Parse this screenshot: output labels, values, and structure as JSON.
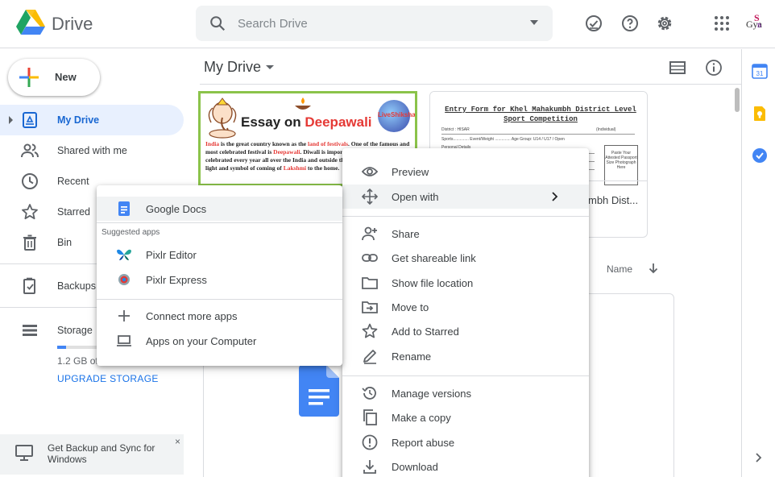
{
  "header": {
    "app_name": "Drive",
    "search_placeholder": "Search Drive",
    "icons": [
      "drive-logo",
      "search-icon",
      "dropdown-icon",
      "offline-check-icon",
      "help-icon",
      "settings-icon",
      "apps-grid-icon",
      "avatar"
    ],
    "avatar": {
      "line1": "S",
      "line2": "Gya",
      "line3": "n"
    }
  },
  "sidebar": {
    "new_label": "New",
    "items": [
      {
        "label": "My Drive",
        "icon": "my-drive-icon",
        "active": true
      },
      {
        "label": "Shared with me",
        "icon": "people-icon"
      },
      {
        "label": "Recent",
        "icon": "clock-icon"
      },
      {
        "label": "Starred",
        "icon": "star-icon"
      },
      {
        "label": "Bin",
        "icon": "trash-icon"
      },
      {
        "label": "Backups",
        "icon": "backup-icon"
      },
      {
        "label": "Storage",
        "icon": "storage-icon"
      }
    ],
    "storage_text": "1.2 GB of",
    "storage_fraction": 0.07,
    "upgrade_label": "UPGRADE STORAGE",
    "backup_banner": {
      "text": "Get Backup and Sync for Windows",
      "close": "×"
    }
  },
  "main": {
    "title": "My Drive",
    "sort_label": "Name",
    "file1": {
      "title_prefix": "Essay on ",
      "title_highlight": "Deepawali",
      "brand": "LiveShiksha",
      "body": [
        {
          "t": "India",
          "r": true
        },
        {
          "t": " is the great country known as the ",
          "r": false
        },
        {
          "t": "land of festivals",
          "r": true
        },
        {
          "t": ". One of the famous and most celebrated festival is ",
          "r": false
        },
        {
          "t": "Deepawali",
          "r": true
        },
        {
          "t": ". Diwali is important festival and being celebrated every year all over the India and outside the country. It is a festival of light and symbol of coming of ",
          "r": false
        },
        {
          "t": "Lakshmi",
          "r": true
        },
        {
          "t": " to the home.",
          "r": false
        }
      ]
    },
    "file2": {
      "title": "Entry Form for Khel Mahakumbh District Level Sport Competition",
      "district": "District : HISAR",
      "category": "(Individual)",
      "fields": "Sports.............. Event/Weight .............. Age Group: U14 / U17 / Open",
      "personal": "Personal Details",
      "photo": "Paste Your Attested Passport Size Photograph Here",
      "name": "mbh Dist..."
    }
  },
  "context_menu": {
    "items": [
      {
        "label": "Preview",
        "icon": "eye-icon"
      },
      {
        "label": "Open with",
        "icon": "move-arrows-icon",
        "submenu": true
      },
      {
        "label": "Share",
        "icon": "person-add-icon"
      },
      {
        "label": "Get shareable link",
        "icon": "link-icon"
      },
      {
        "label": "Show file location",
        "icon": "folder-icon"
      },
      {
        "label": "Move to",
        "icon": "move-to-icon"
      },
      {
        "label": "Add to Starred",
        "icon": "star-icon"
      },
      {
        "label": "Rename",
        "icon": "pencil-icon"
      },
      {
        "label": "Manage versions",
        "icon": "history-icon"
      },
      {
        "label": "Make a copy",
        "icon": "copy-icon"
      },
      {
        "label": "Report abuse",
        "icon": "alert-icon"
      },
      {
        "label": "Download",
        "icon": "download-icon"
      }
    ]
  },
  "open_with_menu": {
    "primary": "Google Docs",
    "suggested_heading": "Suggested apps",
    "suggested": [
      "Pixlr Editor",
      "Pixlr Express"
    ],
    "connect": "Connect more apps",
    "computer": "Apps on your Computer"
  },
  "colors": {
    "accent": "#1a73e8",
    "active_nav_bg": "#e8f0fe",
    "docs_blue": "#4285f4"
  }
}
